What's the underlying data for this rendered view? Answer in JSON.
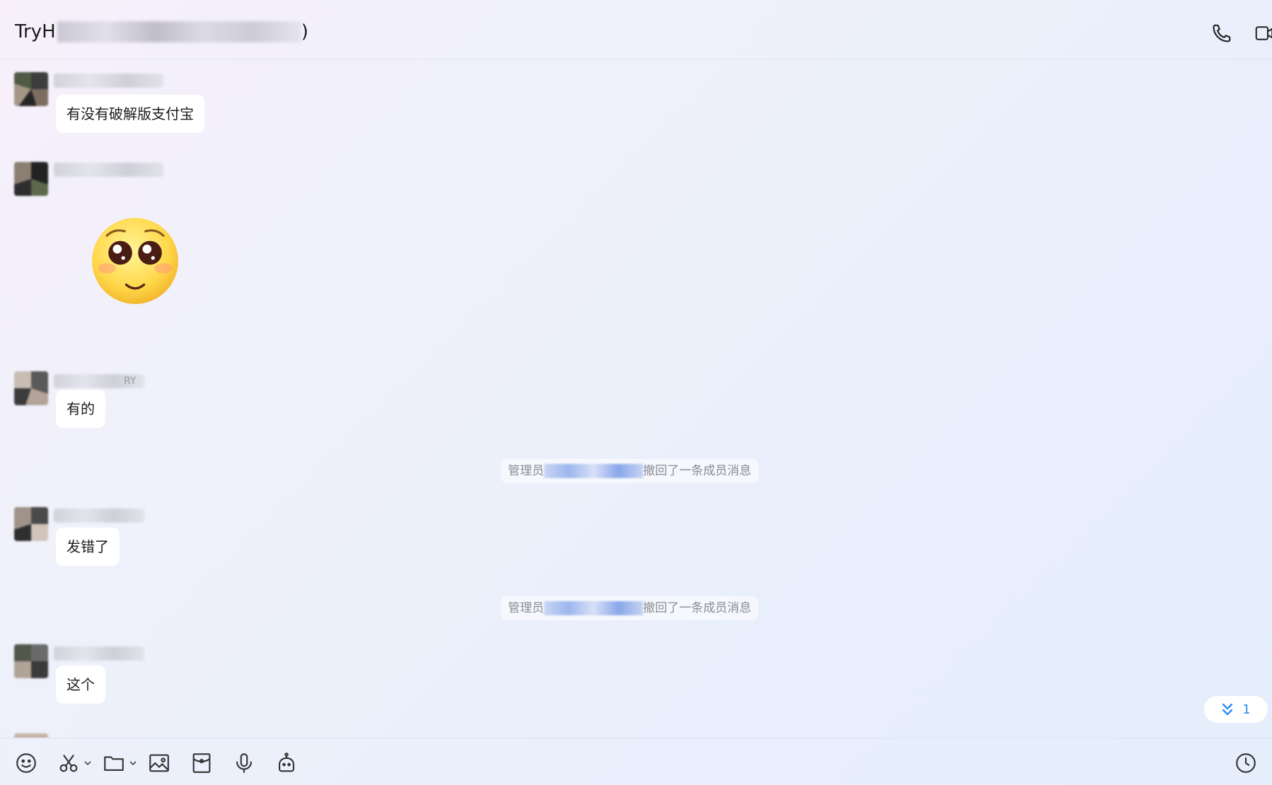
{
  "header": {
    "title_prefix": "TryH",
    "title_suffix": ")",
    "phone_icon": "phone-icon",
    "video_icon": "video-call-icon"
  },
  "messages": [
    {
      "type": "text",
      "text": "有没有破解版支付宝"
    },
    {
      "type": "emoji",
      "emoji": "pleading-face"
    },
    {
      "type": "text",
      "text": "有的"
    },
    {
      "type": "system",
      "prefix": "管理员",
      "suffix": "撤回了一条成员消息"
    },
    {
      "type": "text",
      "text": "发错了"
    },
    {
      "type": "system",
      "prefix": "管理员",
      "suffix": "撤回了一条成员消息"
    },
    {
      "type": "text",
      "text": "这个"
    }
  ],
  "name_fragment": "RY",
  "unread": {
    "count": "1",
    "icon": "double-chevron-down-icon"
  },
  "toolbar": {
    "items": [
      "emoji-icon",
      "scissors-icon",
      "folder-icon",
      "image-icon",
      "red-packet-icon",
      "microphone-icon",
      "robot-icon"
    ],
    "history_icon": "clock-icon"
  }
}
